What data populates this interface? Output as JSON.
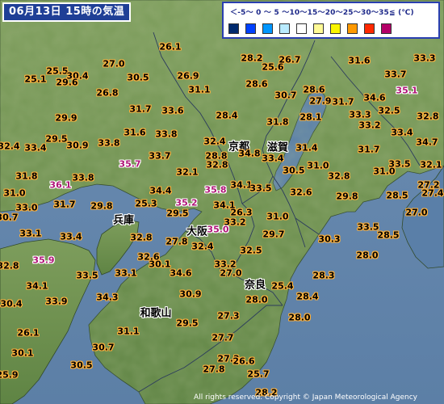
{
  "title": "06月13日 15時の気温",
  "legend": {
    "scale_text": "＜-5～ 0 ～ 5 ～10～15～20～25～30～35≦ (℃)",
    "swatches": [
      {
        "name": "below-minus-5",
        "color": "#002a6e"
      },
      {
        "name": "minus-5-to-0",
        "color": "#0041ff"
      },
      {
        "name": "0-to-5",
        "color": "#0096ff"
      },
      {
        "name": "5-to-10",
        "color": "#b9ebff"
      },
      {
        "name": "10-to-15",
        "color": "#ffffff"
      },
      {
        "name": "15-to-20",
        "color": "#fffa96"
      },
      {
        "name": "20-to-25",
        "color": "#faf500"
      },
      {
        "name": "25-to-30",
        "color": "#ff9900"
      },
      {
        "name": "30-to-35",
        "color": "#ff2800"
      },
      {
        "name": "35-and-above",
        "color": "#b40068"
      }
    ]
  },
  "prefectures": [
    {
      "name": "京都"
    },
    {
      "name": "滋賀"
    },
    {
      "name": "兵庫"
    },
    {
      "name": "大阪"
    },
    {
      "name": "奈良"
    },
    {
      "name": "和歌山"
    }
  ],
  "temperatures": [
    "26.1",
    "27.0",
    "26.7",
    "31.6",
    "33.3",
    "25.1",
    "25.5",
    "28.2",
    "30.4",
    "29.6",
    "30.5",
    "26.9",
    "25.6",
    "33.7",
    "31.1",
    "26.8",
    "28.6",
    "28.6",
    "35.1",
    "30.7",
    "27.9",
    "31.7",
    "34.6",
    "31.7",
    "33.6",
    "32.5",
    "29.9",
    "28.4",
    "28.1",
    "33.3",
    "32.8",
    "31.8",
    "33.2",
    "31.6",
    "33.8",
    "33.4",
    "29.5",
    "30.9",
    "33.8",
    "32.4",
    "34.7",
    "31.4",
    "32.4",
    "33.4",
    "33.7",
    "28.8",
    "34.8",
    "31.7",
    "35.7",
    "33.4",
    "33.5",
    "31.0",
    "30.5",
    "32.1",
    "32.8",
    "31.0",
    "32.8",
    "32.1",
    "31.8",
    "33.8",
    "35.8",
    "36.1",
    "34.1",
    "33.5",
    "27.2",
    "31.0",
    "32.6",
    "29.8",
    "28.5",
    "27.4",
    "33.0",
    "31.7",
    "34.4",
    "35.2",
    "29.8",
    "25.3",
    "34.1",
    "26.3",
    "30.7",
    "29.5",
    "31.0",
    "27.0",
    "33.2",
    "33.5",
    "33.1",
    "32.8",
    "35.0",
    "30.3",
    "28.5",
    "33.4",
    "27.8",
    "29.7",
    "32.4",
    "35.9",
    "32.6",
    "32.5",
    "28.0",
    "32.8",
    "30.1",
    "33.1",
    "34.6",
    "33.2",
    "27.0",
    "28.3",
    "34.1",
    "33.5",
    "25.4",
    "30.4",
    "33.9",
    "34.3",
    "30.9",
    "28.0",
    "28.4",
    "31.1",
    "28.0",
    "29.5",
    "27.3",
    "26.1",
    "27.7",
    "30.1",
    "30.7",
    "27.3",
    "25.9",
    "26.6",
    "25.7",
    "30.5",
    "27.8",
    "28.2"
  ],
  "hot_values": [
    "35.1",
    "35.7",
    "35.8",
    "36.1",
    "35.2",
    "35.0",
    "35.9"
  ],
  "copyright": "All rights reserved. Copyright © Japan Meteorological Agency"
}
